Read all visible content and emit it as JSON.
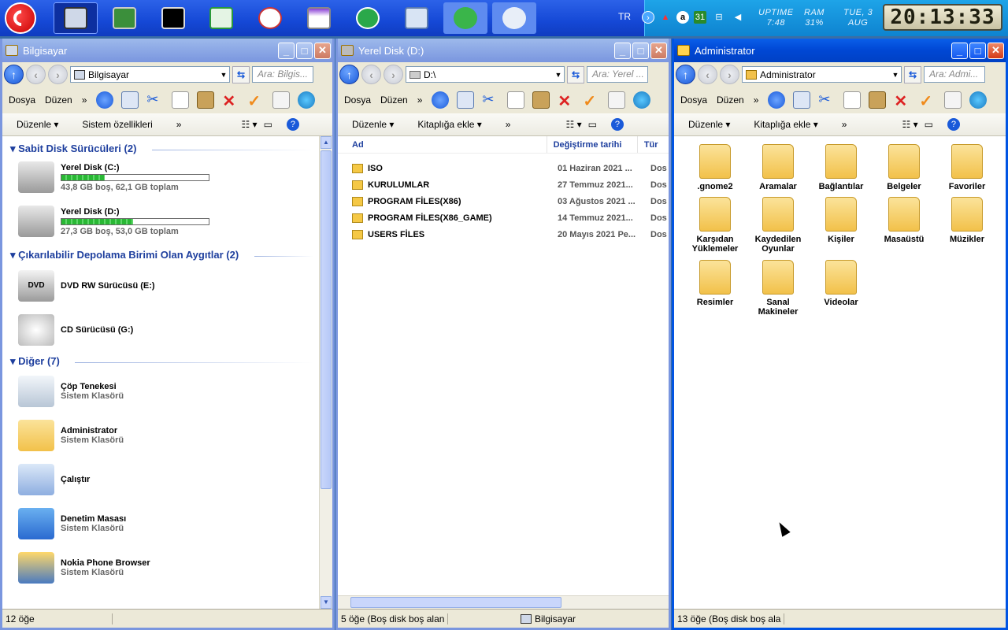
{
  "tray": {
    "lang": "TR",
    "uptime_label": "UPTIME",
    "uptime": "7:48",
    "ram_label": "RAM",
    "ram": "31%",
    "date_day": "TUE, 3",
    "date_mon": "AUG",
    "clock": "20:13:33",
    "cal": "31"
  },
  "win1": {
    "title": "Bilgisayar",
    "address": "Bilgisayar",
    "search": "Ara: Bilgis...",
    "menu": [
      "Dosya",
      "Düzen"
    ],
    "cmd": [
      "Düzenle",
      "Sistem özellikleri"
    ],
    "groups": [
      {
        "label": "Sabit Disk Sürücüleri (2)"
      },
      {
        "label": "Çıkarılabilir Depolama Birimi Olan Aygıtlar (2)"
      },
      {
        "label": "Diğer (7)"
      }
    ],
    "drives": [
      {
        "name": "Yerel Disk (C:)",
        "info": "43,8 GB boş, 62,1 GB toplam",
        "used": 0.295
      },
      {
        "name": "Yerel Disk (D:)",
        "info": "27,3 GB boş, 53,0 GB toplam",
        "used": 0.485
      }
    ],
    "removable": [
      {
        "name": "DVD RW Sürücüsü (E:)",
        "badge": "DVD"
      },
      {
        "name": "CD Sürücüsü (G:)"
      }
    ],
    "other": [
      {
        "name": "Çöp Tenekesi",
        "sub": "Sistem Klasörü"
      },
      {
        "name": "Administrator",
        "sub": "Sistem Klasörü"
      },
      {
        "name": "Çalıştır",
        "sub": ""
      },
      {
        "name": "Denetim Masası",
        "sub": "Sistem Klasörü"
      },
      {
        "name": "Nokia Phone Browser",
        "sub": "Sistem Klasörü"
      }
    ],
    "status": "12 öğe"
  },
  "win2": {
    "title": "Yerel Disk (D:)",
    "address": "D:\\",
    "search": "Ara: Yerel ...",
    "menu": [
      "Dosya",
      "Düzen"
    ],
    "cmd": [
      "Düzenle",
      "Kitaplığa ekle"
    ],
    "columns": [
      "Ad",
      "Değiştirme tarihi",
      "Tür"
    ],
    "files": [
      {
        "name": "ISO",
        "date": "01 Haziran 2021 ...",
        "type": "Dos"
      },
      {
        "name": "KURULUMLAR",
        "date": "27 Temmuz 2021...",
        "type": "Dos"
      },
      {
        "name": "PROGRAM FİLES(X86)",
        "date": "03 Ağustos 2021 ...",
        "type": "Dos"
      },
      {
        "name": "PROGRAM FİLES(X86_GAME)",
        "date": "14 Temmuz 2021...",
        "type": "Dos"
      },
      {
        "name": "USERS FİLES",
        "date": "20 Mayıs 2021 Pe...",
        "type": "Dos"
      }
    ],
    "status": "5 öğe (Boş disk boş alan",
    "status2": "Bilgisayar"
  },
  "win3": {
    "title": "Administrator",
    "address": "Administrator",
    "search": "Ara: Admi...",
    "menu": [
      "Dosya",
      "Düzen"
    ],
    "cmd": [
      "Düzenle",
      "Kitaplığa ekle"
    ],
    "folders": [
      {
        "l1": ".gnome2",
        "l2": ""
      },
      {
        "l1": "Aramalar",
        "l2": ""
      },
      {
        "l1": "Bağlantılar",
        "l2": ""
      },
      {
        "l1": "Belgeler",
        "l2": ""
      },
      {
        "l1": "Favoriler",
        "l2": ""
      },
      {
        "l1": "Karşıdan",
        "l2": "Yüklemeler"
      },
      {
        "l1": "Kaydedilen",
        "l2": "Oyunlar"
      },
      {
        "l1": "Kişiler",
        "l2": ""
      },
      {
        "l1": "Masaüstü",
        "l2": ""
      },
      {
        "l1": "Müzikler",
        "l2": ""
      },
      {
        "l1": "Resimler",
        "l2": ""
      },
      {
        "l1": "Sanal",
        "l2": "Makineler"
      },
      {
        "l1": "Videolar",
        "l2": ""
      }
    ],
    "status": "13 öğe (Boş disk boş ala"
  }
}
